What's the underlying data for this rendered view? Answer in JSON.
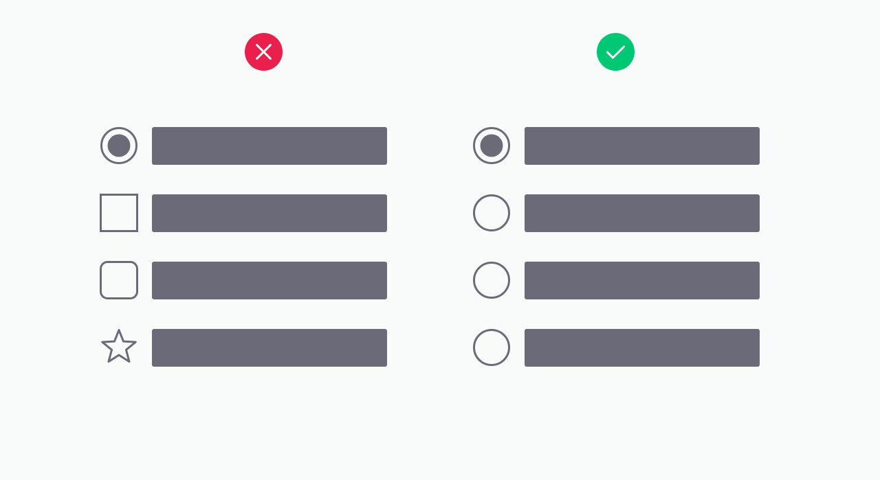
{
  "colors": {
    "background": "#f9fafa",
    "ink": "#6b6a79",
    "wrong": "#e8204b",
    "right": "#00c774",
    "badge_mark": "#ffffff"
  },
  "badges": [
    {
      "icon": "close-icon",
      "meaning": "incorrect"
    },
    {
      "icon": "check-icon",
      "meaning": "correct"
    }
  ],
  "columns": [
    {
      "rows": [
        {
          "control": "radio-selected"
        },
        {
          "control": "square-checkbox"
        },
        {
          "control": "rounded-checkbox"
        },
        {
          "control": "star"
        }
      ]
    },
    {
      "rows": [
        {
          "control": "radio-selected"
        },
        {
          "control": "radio"
        },
        {
          "control": "radio"
        },
        {
          "control": "radio"
        }
      ]
    }
  ]
}
